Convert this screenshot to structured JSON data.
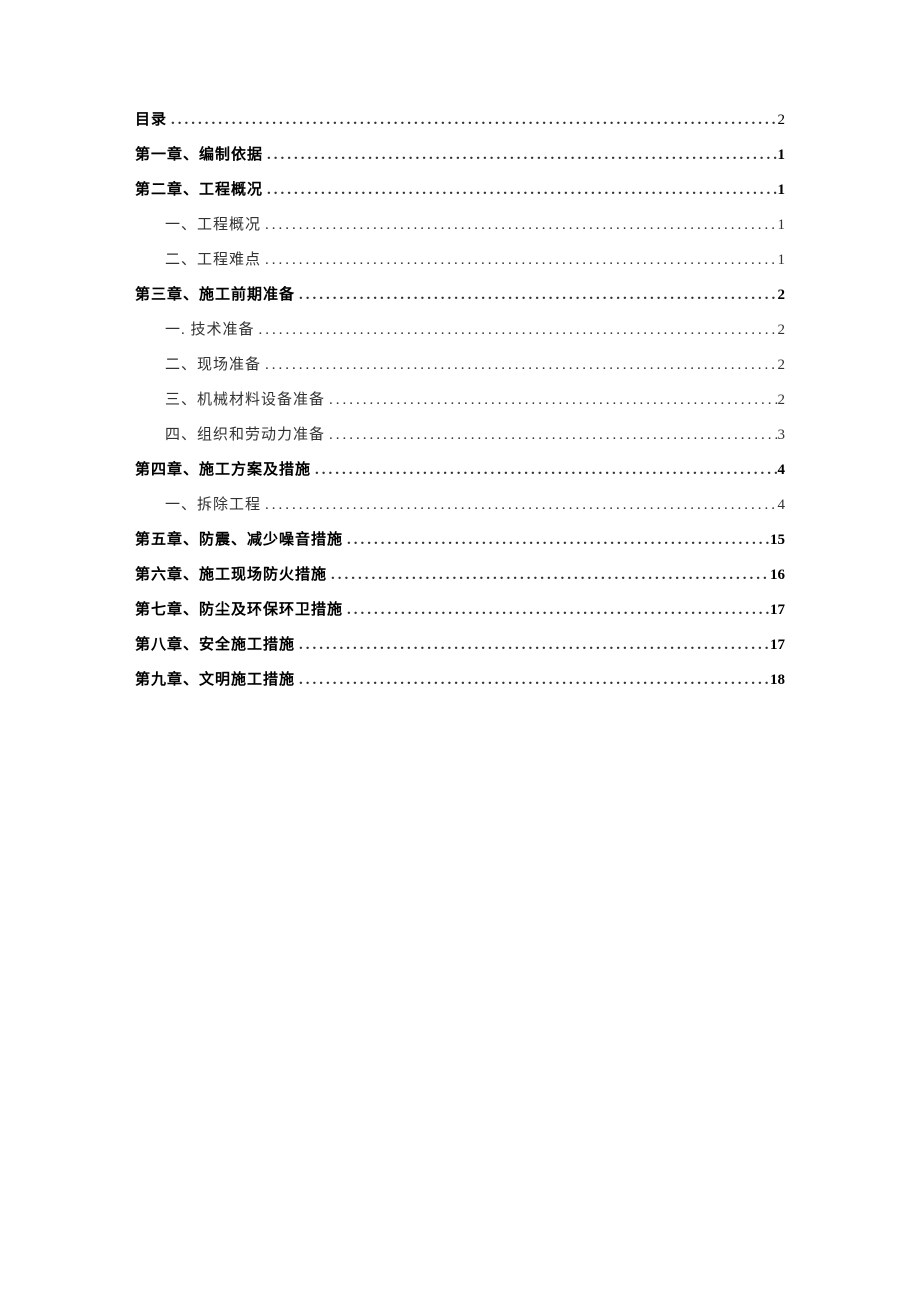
{
  "toc": [
    {
      "level": 1,
      "label": "目录",
      "page": "2",
      "first": true
    },
    {
      "level": 1,
      "label": "第一章、编制依据",
      "page": "1"
    },
    {
      "level": 1,
      "label": "第二章、工程概况",
      "page": "1"
    },
    {
      "level": 2,
      "label": "一、工程概况",
      "page": "1"
    },
    {
      "level": 2,
      "label": "二、工程难点",
      "page": "1"
    },
    {
      "level": 1,
      "label": "第三章、施工前期准备",
      "page": "2"
    },
    {
      "level": 2,
      "label": "一. 技术准备",
      "page": "2"
    },
    {
      "level": 2,
      "label": "二、现场准备",
      "page": "2"
    },
    {
      "level": 2,
      "label": "三、机械材料设备准备",
      "page": "2"
    },
    {
      "level": 2,
      "label": "四、组织和劳动力准备",
      "page": "3"
    },
    {
      "level": 1,
      "label": "第四章、施工方案及措施",
      "page": "4"
    },
    {
      "level": 2,
      "label": "一、拆除工程",
      "page": "4"
    },
    {
      "level": 1,
      "label": "第五章、防震、减少噪音措施",
      "page": "15"
    },
    {
      "level": 1,
      "label": "第六章、施工现场防火措施",
      "page": "16"
    },
    {
      "level": 1,
      "label": "第七章、防尘及环保环卫措施",
      "page": "17"
    },
    {
      "level": 1,
      "label": "第八章、安全施工措施",
      "page": "17"
    },
    {
      "level": 1,
      "label": "第九章、文明施工措施",
      "page": "18"
    }
  ]
}
